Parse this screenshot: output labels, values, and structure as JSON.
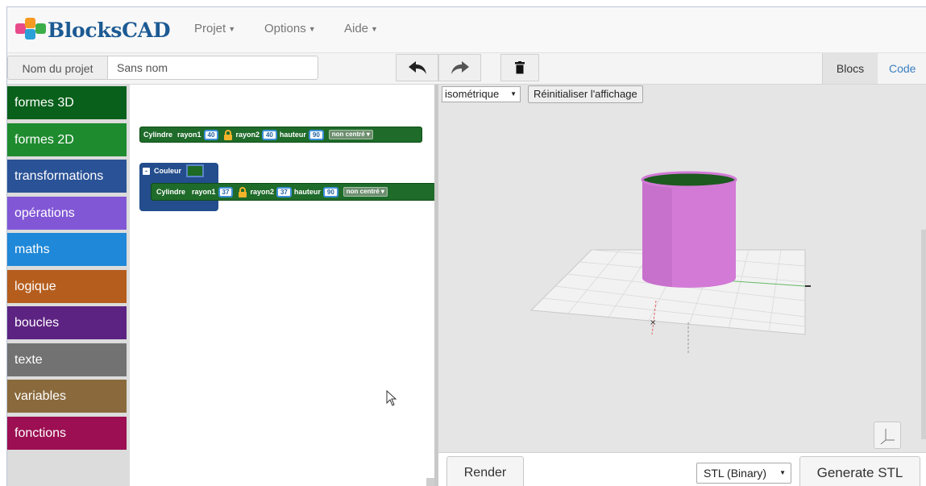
{
  "app": {
    "brand": "BlocksCAD",
    "menus": [
      "Projet",
      "Options",
      "Aide"
    ]
  },
  "toolbar": {
    "project_label": "Nom du projet",
    "project_name": "Sans nom",
    "undo_icon": "undo-arrow-icon",
    "redo_icon": "redo-arrow-icon",
    "trash_icon": "trash-icon",
    "tabs": [
      "Blocs",
      "Code"
    ],
    "active_tab": "Blocs"
  },
  "categories": [
    {
      "label": "formes 3D",
      "color": "#08601a"
    },
    {
      "label": "formes 2D",
      "color": "#1e8b2e"
    },
    {
      "label": "transformations",
      "color": "#2a5296"
    },
    {
      "label": "opérations",
      "color": "#8257d6"
    },
    {
      "label": "maths",
      "color": "#1f88d8"
    },
    {
      "label": "logique",
      "color": "#b55d1d"
    },
    {
      "label": "boucles",
      "color": "#5d2382"
    },
    {
      "label": "texte",
      "color": "#727272"
    },
    {
      "label": "variables",
      "color": "#8a6a3c"
    },
    {
      "label": "fonctions",
      "color": "#9c0f52"
    }
  ],
  "blocks": {
    "cylinder1": {
      "name": "Cylindre",
      "r1_label": "rayon1",
      "r1": "40",
      "r2_label": "rayon2",
      "r2": "40",
      "h_label": "hauteur",
      "h": "90",
      "center": "non centré"
    },
    "color_block": {
      "label": "Couleur",
      "toggle": "-"
    },
    "cylinder2": {
      "name": "Cylindre",
      "r1_label": "rayon1",
      "r1": "37",
      "r2_label": "rayon2",
      "r2": "37",
      "h_label": "hauteur",
      "h": "90",
      "center": "non centré"
    }
  },
  "viewer": {
    "view_select": "isométrique",
    "reset_button": "Réinitialiser l'affichage",
    "axes_icon": "axes-toggle-icon",
    "render_button": "Render",
    "format_select": "STL (Binary)",
    "generate_button": "Generate STL"
  },
  "colors": {
    "cylinder": "#d27ad6",
    "cylinder_top": "#1c5a1f",
    "brand": "#1c5a93"
  }
}
